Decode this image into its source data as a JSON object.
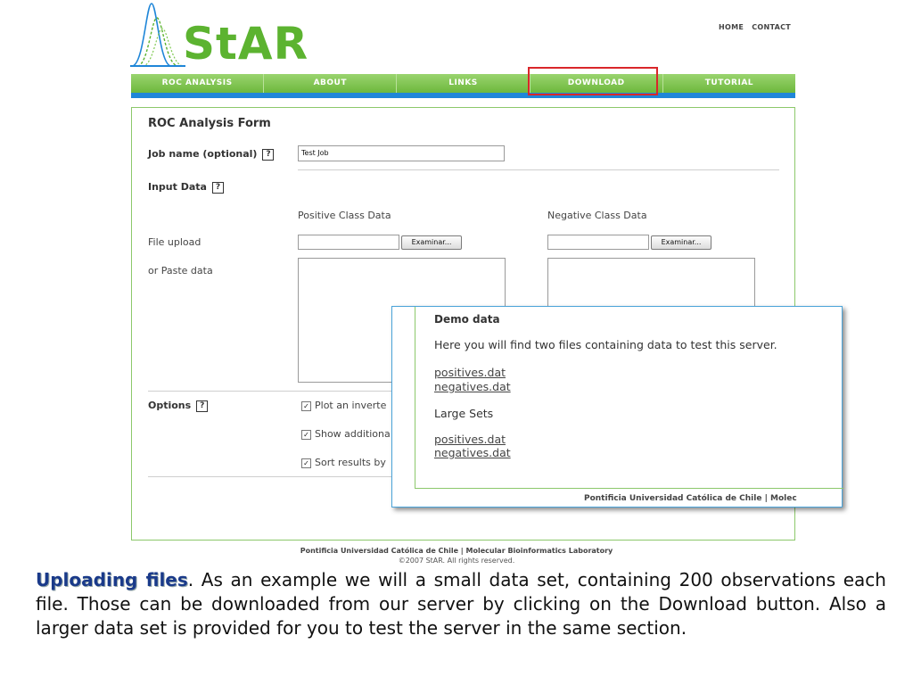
{
  "header": {
    "logo_text": "StAR",
    "top_links": [
      "HOME",
      "CONTACT"
    ]
  },
  "nav": {
    "items": [
      "ROC ANALYSIS",
      "ABOUT",
      "LINKS",
      "DOWNLOAD",
      "TUTORIAL"
    ],
    "highlighted": "DOWNLOAD",
    "highlight_color": "#d9262a"
  },
  "form": {
    "title": "ROC Analysis Form",
    "job_name_label": "Job name (optional)",
    "job_name_value": "Test Job",
    "input_data_label": "Input Data",
    "positive_header": "Positive Class Data",
    "negative_header": "Negative Class Data",
    "file_upload_label": "File upload",
    "browse_label": "Examinar...",
    "paste_label": "or Paste data",
    "options_label": "Options",
    "help_glyph": "?",
    "options": [
      {
        "label": "Plot an inverte",
        "checked": true
      },
      {
        "label": "Show additiona",
        "checked": true
      },
      {
        "label": "Sort results by",
        "checked": true
      }
    ]
  },
  "popup": {
    "title": "Demo data",
    "description": "Here you will find two files containing data to test this server.",
    "links": [
      "positives.dat",
      "negatives.dat"
    ],
    "large_sets_label": "Large Sets",
    "large_links": [
      "positives.dat",
      "negatives.dat"
    ],
    "footer": "Pontificia Universidad Católica de Chile  |  Molec"
  },
  "footer": {
    "line1": "Pontificia Universidad Católica de Chile  |  Molecular Bioinformatics Laboratory",
    "line2": "©2007 StAR. All rights reserved."
  },
  "description": {
    "title": "Uploading files",
    "text": ". As an example we will a small data set, containing 200 observations each file. Those can be downloaded from our server by clicking on the Download button. Also a larger data set is provided for you to test the server in the same section."
  },
  "colors": {
    "nav_green": "#86c95c",
    "nav_blue_bar": "#1f86d8",
    "panel_border": "#8cc86b",
    "popup_border": "#4aa3d9"
  }
}
